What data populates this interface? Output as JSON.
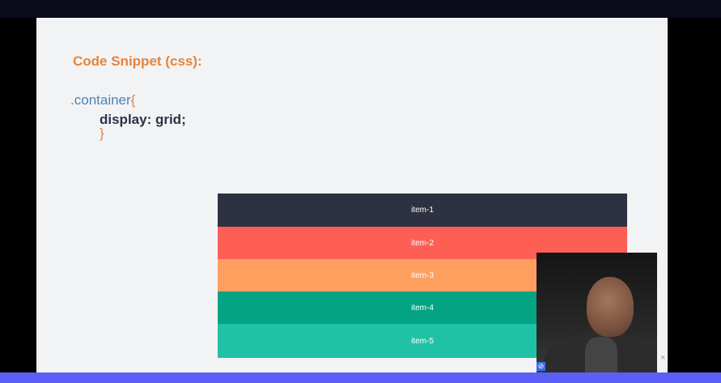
{
  "slide": {
    "title": "Code Snippet (css):",
    "code": {
      "selector_dot": ".",
      "selector": "container",
      "open_brace": "{",
      "declaration": "display: grid;",
      "close_brace": "}"
    },
    "grid_items": [
      "item-1",
      "item-2",
      "item-3",
      "item-4",
      "item-5"
    ]
  },
  "colors": {
    "title": "#e8833a",
    "selector": "#4b84b5",
    "item_1": "#2d3142",
    "item_2": "#fe5f55",
    "item_3": "#fe9f60",
    "item_4": "#04a384",
    "item_5": "#1fc2a4",
    "bottom_bar": "#5b5ff5"
  },
  "webcam": {
    "close_label": "×",
    "corner_icon": "⊘"
  }
}
